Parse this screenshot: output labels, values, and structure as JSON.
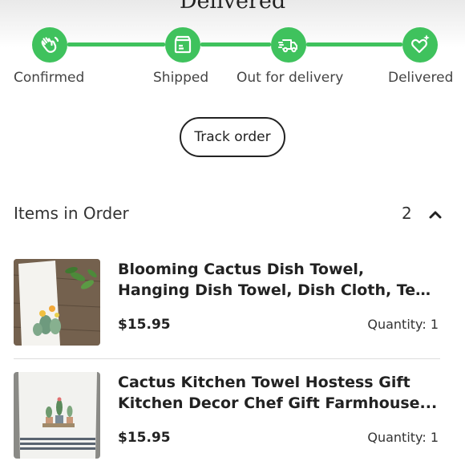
{
  "status": {
    "title": "Delivered"
  },
  "progress": {
    "color": "#3fc25d",
    "steps": [
      {
        "label": "Confirmed",
        "icon": "waving-hand-icon"
      },
      {
        "label": "Shipped",
        "icon": "package-box-icon"
      },
      {
        "label": "Out for delivery",
        "icon": "delivery-truck-icon"
      },
      {
        "label": "Delivered",
        "icon": "heart-sparkle-icon"
      }
    ]
  },
  "track_button": {
    "label": "Track order"
  },
  "items_section": {
    "title": "Items in Order",
    "count": "2",
    "chevron": "chevron-up-icon"
  },
  "items": [
    {
      "title_line1": "Blooming Cactus Dish Towel,",
      "title_line2": "Hanging Dish Towel, Dish Cloth, Tea...",
      "price": "$15.95",
      "quantity": "Quantity: 1"
    },
    {
      "title_line1": "Cactus Kitchen Towel Hostess Gift",
      "title_line2": "Kitchen Decor Chef Gift Farmhouse...",
      "price": "$15.95",
      "quantity": "Quantity: 1"
    }
  ]
}
